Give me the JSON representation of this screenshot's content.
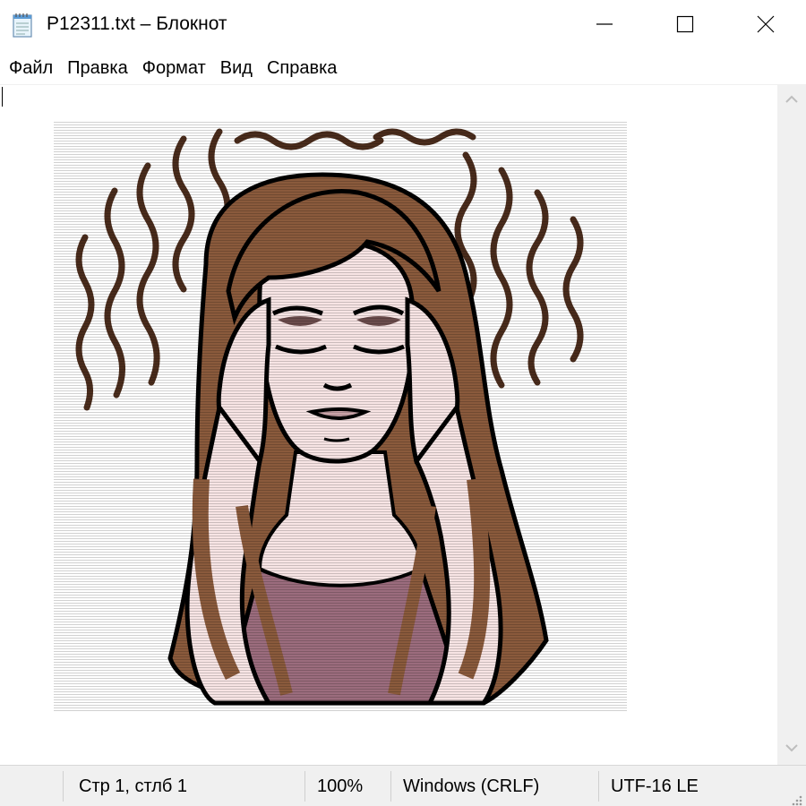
{
  "window": {
    "title": "P12311.txt – Блокнот",
    "icon": "notepad-icon",
    "controls": {
      "minimize_icon": "minimize-icon",
      "maximize_icon": "maximize-icon",
      "close_icon": "close-icon"
    }
  },
  "menu": {
    "items": [
      {
        "label": "Файл"
      },
      {
        "label": "Правка"
      },
      {
        "label": "Формат"
      },
      {
        "label": "Вид"
      },
      {
        "label": "Справка"
      }
    ]
  },
  "editor": {
    "content": "illustration-woman-headache"
  },
  "statusbar": {
    "position": "Стр 1, стлб 1",
    "zoom": "100%",
    "line_endings": "Windows (CRLF)",
    "encoding": "UTF-16 LE"
  },
  "colors": {
    "hair": "#8a5a3c",
    "skin": "#f7e4e4",
    "shirt": "#9b6c7d",
    "outline": "#000000",
    "chrome": "#f0f0f0"
  }
}
